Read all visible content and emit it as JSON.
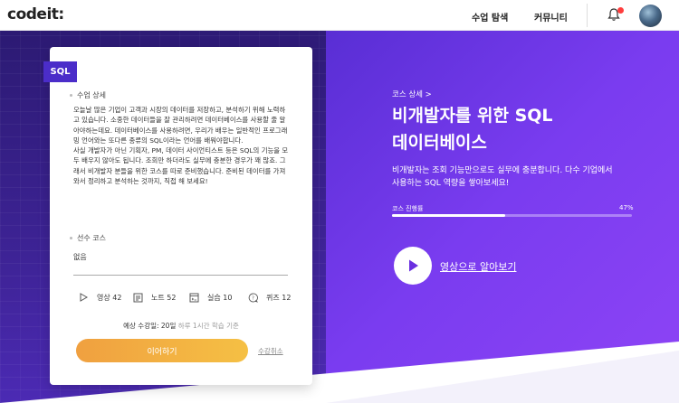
{
  "header": {
    "logo": "codeit:",
    "nav": [
      "수업 탐색",
      "커뮤니티"
    ]
  },
  "card": {
    "tag": "SQL",
    "description_title": "수업 상세",
    "description": [
      "오늘날 많은 기업이 고객과 시장의 데이터를 저장하고, 분석하기 위해 노력하고 있습니다. 소중한 데이터들을 잘 관리하려면 데이터베이스를 사용할 줄 알아야하는데요. 데이터베이스를 사용하려면, 우리가 배우는 일반적인 프로그래밍 언어와는 또다른 종류의 SQL이라는 언어를 배워야합니다.",
      "사실 개발자가 아닌 기획자, PM, 데이터 사이언티스트 등은 SQL의 기능을 모두 배우지 않아도 됩니다. 조회만 하더라도 실무에 충분한 경우가 꽤 많죠. 그래서 비개발자 분들을 위한 코스를 따로 준비했습니다. 준비된 데이터를 가져와서 정리하고 분석하는 것까지, 직접 해 보세요!"
    ],
    "prereq_title": "선수 코스",
    "prereq_value": "없음",
    "stats": [
      {
        "icon": "video-play-icon",
        "label": "영상 42"
      },
      {
        "icon": "note-icon",
        "label": "노트 52"
      },
      {
        "icon": "code-practice-icon",
        "label": "실습 10"
      },
      {
        "icon": "quiz-icon",
        "label": "퀴즈 12"
      }
    ],
    "expected_prefix": "예상 수강일: 20일",
    "expected_hint": "하루 1시간 학습 기준",
    "continue_label": "이어하기",
    "cancel_label": "수강취소"
  },
  "hero": {
    "breadcrumb": "코스 상세 >",
    "title_line1": "비개발자를 위한 SQL",
    "title_line2": "데이터베이스",
    "desc_line1": "비개발자는 조회 기능만으로도 실무에 충분합니다. 다수 기업에서",
    "desc_line2": "사용하는 SQL 역량을 쌓아보세요!",
    "progress_label": "코스 진행률",
    "progress_text": "47%",
    "progress_value": 0.47,
    "video_label": "영상으로 알아보기"
  },
  "colors": {
    "accent": "#4b2dc9",
    "button_start": "#f0a040",
    "button_end": "#f5c044",
    "badge": "#ff3d3d"
  }
}
